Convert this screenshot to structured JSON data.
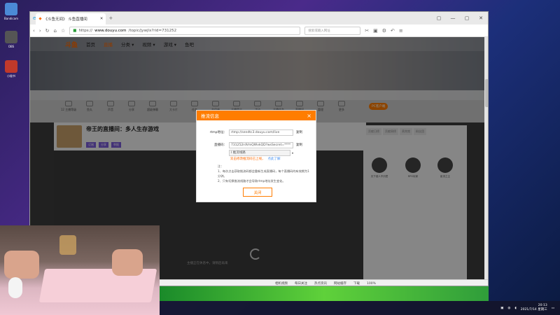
{
  "desktop": {
    "icons": [
      {
        "label": "Bandicam",
        "color": "#4b8ad6"
      },
      {
        "label": "OBS",
        "color": "#555"
      },
      {
        "label": "小秘书",
        "color": "#c0392b"
      }
    ]
  },
  "browser": {
    "tab_title": "《斗鱼无间》 斗鱼直播间",
    "url_prefix": "https://",
    "url_domain": "www.douyu.com",
    "url_path": "/topic/jywjlx?rid=731252",
    "search_placeholder": "搜索或输入网址",
    "window_buttons": [
      "▢",
      "—",
      "▢",
      "✕"
    ]
  },
  "site": {
    "logo": "斗鱼",
    "nav": [
      "首页",
      "直播",
      "分类 ▾",
      "视频 ▾",
      "游戏 ▾",
      "鱼吧"
    ],
    "active_nav": "直播",
    "tools": [
      "12 主播等级",
      "鱼丸",
      "声音",
      "分享",
      "超级弹幕",
      "大卡片",
      "任务",
      "节目单",
      "主播简介",
      "活动",
      "主播任务",
      "直播间",
      "管理",
      "更多"
    ],
    "room_title": "帝王的直播间：多人生存游戏",
    "room_tags": [
      "订阅",
      "分享",
      "举报"
    ],
    "pc_badge": "PC客户端"
  },
  "right_panel": {
    "tabs": [
      "贡献日榜",
      "贡献周榜",
      "贵宾席",
      "粉丝团"
    ],
    "fans": [
      {
        "name": "天下谁人不识君"
      },
      {
        "name": "RPG玩家"
      },
      {
        "name": "影流之主"
      }
    ]
  },
  "video": {
    "offline_msg": "主播正在休息中，请稍后再来"
  },
  "dialog": {
    "title": "推流信息",
    "rtmp_label": "rtmp地址：",
    "rtmp_value": "rtmp://sendtc3.douyu.com/live",
    "code_label": "直播码：",
    "code_value": "731252rdVmQWvkQD?wsSecret=****",
    "select_value": "Ⅰ 推流线路",
    "copy_label": "复制",
    "warning": "双击修改推流码已上线，",
    "warning_link": "点此了解",
    "notes_title": "注：",
    "notes": [
      "1、每次点击获取推流码都会重新生成直播码，每个直播码的有效期为1分钟。",
      "2、只有切换推流线路才会导致rtmp地址发生变化。"
    ],
    "close_label": "关闭"
  },
  "statusbar": [
    "相机视频",
    "每日关注",
    "热点资讯",
    "网站缓存",
    "下载",
    "100%"
  ],
  "taskbar": {
    "time": "20:13",
    "date": "2021/7/14 星期三"
  }
}
